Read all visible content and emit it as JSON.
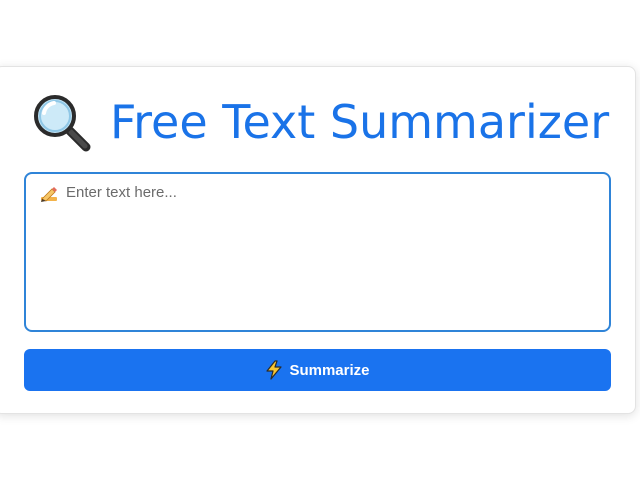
{
  "header": {
    "title": "Free Text Summarizer",
    "icon": "magnifying-glass-icon"
  },
  "input": {
    "placeholder": "Enter text here...",
    "value": "",
    "icon": "writing-hand-icon"
  },
  "actions": {
    "summarize_label": "Summarize",
    "summarize_icon": "lightning-bolt-icon"
  },
  "colors": {
    "accent": "#1a73e8",
    "button": "#1a73f0",
    "input_border": "#2f84d8"
  }
}
